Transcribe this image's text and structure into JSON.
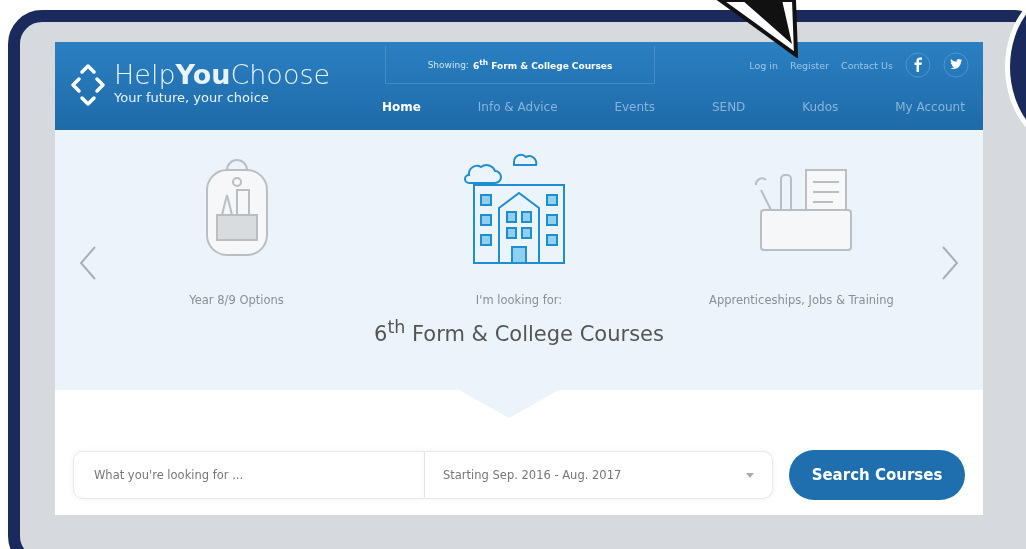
{
  "header": {
    "logo": {
      "name_light": "Help",
      "name_bold": "You",
      "name_end": "Choose",
      "tagline": "Your future, your choice"
    },
    "showing": {
      "label": "Showing:",
      "value": "6$^{th}$ Form & College Courses"
    },
    "links": [
      "Log in",
      "Register",
      "Contact Us"
    ],
    "social": [
      {
        "kind": "facebook"
      },
      {
        "kind": "twitter"
      }
    ],
    "nav": [
      {
        "label": "Home",
        "selected": true
      },
      {
        "label": "Info & Advice",
        "selected": false
      },
      {
        "label": "Events",
        "selected": false
      },
      {
        "label": "SEND",
        "selected": false
      },
      {
        "label": "Kudos",
        "selected": false
      },
      {
        "label": "My Account",
        "selected": false
      }
    ]
  },
  "carousel": {
    "items": [
      {
        "kind": "backpack",
        "label": "Year 8/9 Options",
        "selected": false
      },
      {
        "kind": "building",
        "label": "I'm looking for:",
        "title": "6$^{th}$ Form & College Courses",
        "selected": true
      },
      {
        "kind": "toolbox",
        "label": "Apprenticeships, Jobs & Training",
        "selected": false
      }
    ]
  },
  "search": {
    "placeholder": "What you're looking for ...",
    "date_range": "Starting Sep. 2016 - Aug. 2017",
    "button": "Search Courses"
  }
}
